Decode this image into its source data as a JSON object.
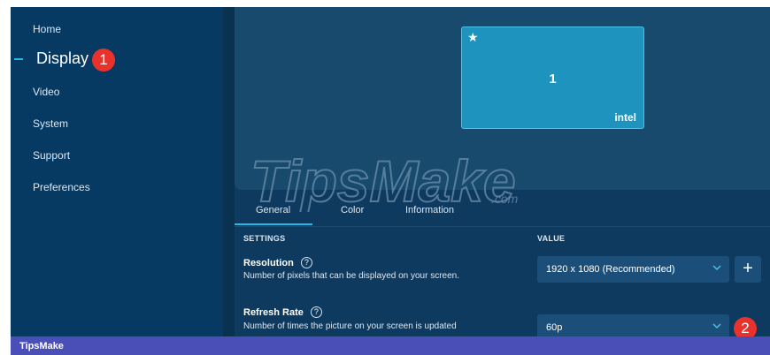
{
  "sidebar": {
    "items": [
      {
        "label": "Home"
      },
      {
        "label": "Display"
      },
      {
        "label": "Video"
      },
      {
        "label": "System"
      },
      {
        "label": "Support"
      },
      {
        "label": "Preferences"
      }
    ],
    "active_badge": "1"
  },
  "display": {
    "monitor_number": "1",
    "monitor_brand": "intel",
    "star": "★"
  },
  "watermark": {
    "text": "TipsMake",
    "suffix": ".com"
  },
  "tabs": [
    {
      "label": "General"
    },
    {
      "label": "Color"
    },
    {
      "label": "Information"
    }
  ],
  "settings": {
    "header_settings": "SETTINGS",
    "header_value": "VALUE",
    "resolution": {
      "title": "Resolution",
      "description": "Number of pixels that can be displayed on your screen.",
      "value": "1920 x 1080 (Recommended)",
      "help": "?"
    },
    "refresh_rate": {
      "title": "Refresh Rate",
      "description": "Number of times the picture on your screen is updated",
      "value": "60p",
      "help": "?",
      "badge": "2"
    },
    "plus": "+"
  },
  "footer": {
    "label": "TipsMake"
  },
  "colors": {
    "accent": "#27b8e8",
    "badge": "#e8322b",
    "footer": "#4a4fb8"
  }
}
